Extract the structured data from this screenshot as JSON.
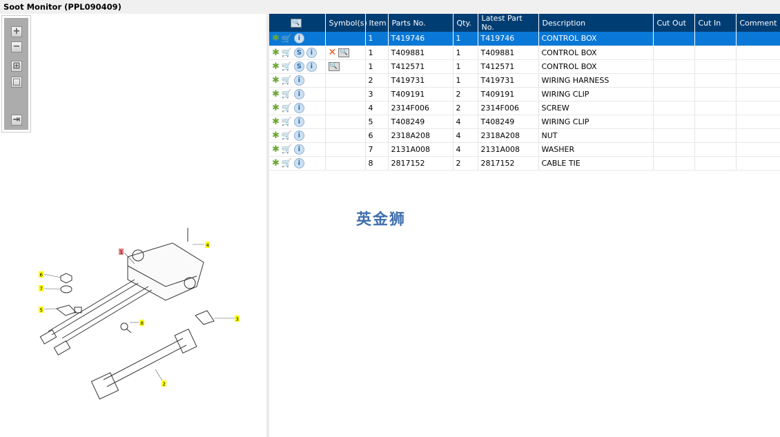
{
  "title": "Soot Monitor (PPL090409)",
  "toolbar": {
    "zoom_in": "+",
    "zoom_out": "−",
    "fit": "⊞",
    "actual": "□",
    "export": "⇥"
  },
  "diagram": {
    "callouts": [
      "1",
      "2",
      "3",
      "4",
      "5",
      "6",
      "7",
      "8"
    ]
  },
  "columns": [
    "Symbol(s)",
    "Item",
    "Parts No.",
    "Qty.",
    "Latest Part No.",
    "Description",
    "Cut Out",
    "Cut In",
    "Comment"
  ],
  "rows": [
    {
      "s": false,
      "x": false,
      "book": false,
      "item": "1",
      "part": "T419746",
      "qty": "1",
      "latest": "T419746",
      "desc": "CONTROL BOX"
    },
    {
      "s": true,
      "x": true,
      "book": true,
      "item": "1",
      "part": "T409881",
      "qty": "1",
      "latest": "T409881",
      "desc": "CONTROL BOX"
    },
    {
      "s": true,
      "x": false,
      "book": true,
      "item": "1",
      "part": "T412571",
      "qty": "1",
      "latest": "T412571",
      "desc": "CONTROL BOX"
    },
    {
      "s": false,
      "x": false,
      "book": false,
      "item": "2",
      "part": "T419731",
      "qty": "1",
      "latest": "T419731",
      "desc": "WIRING HARNESS"
    },
    {
      "s": false,
      "x": false,
      "book": false,
      "item": "3",
      "part": "T409191",
      "qty": "2",
      "latest": "T409191",
      "desc": "WIRING CLIP"
    },
    {
      "s": false,
      "x": false,
      "book": false,
      "item": "4",
      "part": "2314F006",
      "qty": "2",
      "latest": "2314F006",
      "desc": "SCREW"
    },
    {
      "s": false,
      "x": false,
      "book": false,
      "item": "5",
      "part": "T408249",
      "qty": "4",
      "latest": "T408249",
      "desc": "WIRING CLIP"
    },
    {
      "s": false,
      "x": false,
      "book": false,
      "item": "6",
      "part": "2318A208",
      "qty": "4",
      "latest": "2318A208",
      "desc": "NUT"
    },
    {
      "s": false,
      "x": false,
      "book": false,
      "item": "7",
      "part": "2131A008",
      "qty": "4",
      "latest": "2131A008",
      "desc": "WASHER"
    },
    {
      "s": false,
      "x": false,
      "book": false,
      "item": "8",
      "part": "2817152",
      "qty": "2",
      "latest": "2817152",
      "desc": "CABLE TIE"
    }
  ],
  "icons": {
    "gear": "✱",
    "cart": "🛒",
    "s": "S",
    "info": "i",
    "x": "✕",
    "book": "🔍"
  },
  "watermark": "英金狮",
  "colors": {
    "header": "#003d73",
    "selected": "#0a78d7",
    "callout": "#ffff00",
    "callout_selected": "#f08080"
  }
}
